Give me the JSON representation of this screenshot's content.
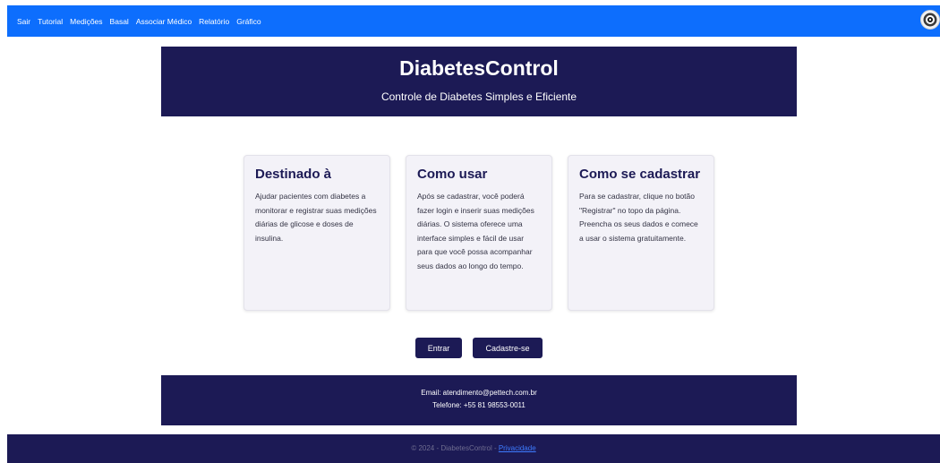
{
  "navbar": {
    "links": [
      "Sair",
      "Tutorial",
      "Medições",
      "Basal",
      "Associar Médico",
      "Relatório",
      "Gráfico"
    ]
  },
  "hero": {
    "title": "DiabetesControl",
    "subtitle": "Controle de Diabetes Simples e Eficiente"
  },
  "cards": [
    {
      "title": "Destinado à",
      "text": "Ajudar pacientes com diabetes a monitorar e registrar suas medições diárias de glicose e doses de insulina."
    },
    {
      "title": "Como usar",
      "text": "Após se cadastrar, você poderá fazer login e inserir suas medições diárias. O sistema oferece uma interface simples e fácil de usar para que você possa acompanhar seus dados ao longo do tempo."
    },
    {
      "title": "Como se cadastrar",
      "text": "Para se cadastrar, clique no botão \"Registrar\" no topo da página. Preencha os seus dados e comece a usar o sistema gratuitamente."
    }
  ],
  "actions": {
    "login_label": "Entrar",
    "register_label": "Cadastre-se"
  },
  "contact": {
    "email": "Email: atendimento@pettech.com.br",
    "phone": "Telefone: +55 81 98553-0011"
  },
  "footer": {
    "copyright": "© 2024 - DiabetesControl - ",
    "privacy_label": "Privacidade"
  },
  "icons": {
    "avatar": "user-avatar-icon"
  }
}
